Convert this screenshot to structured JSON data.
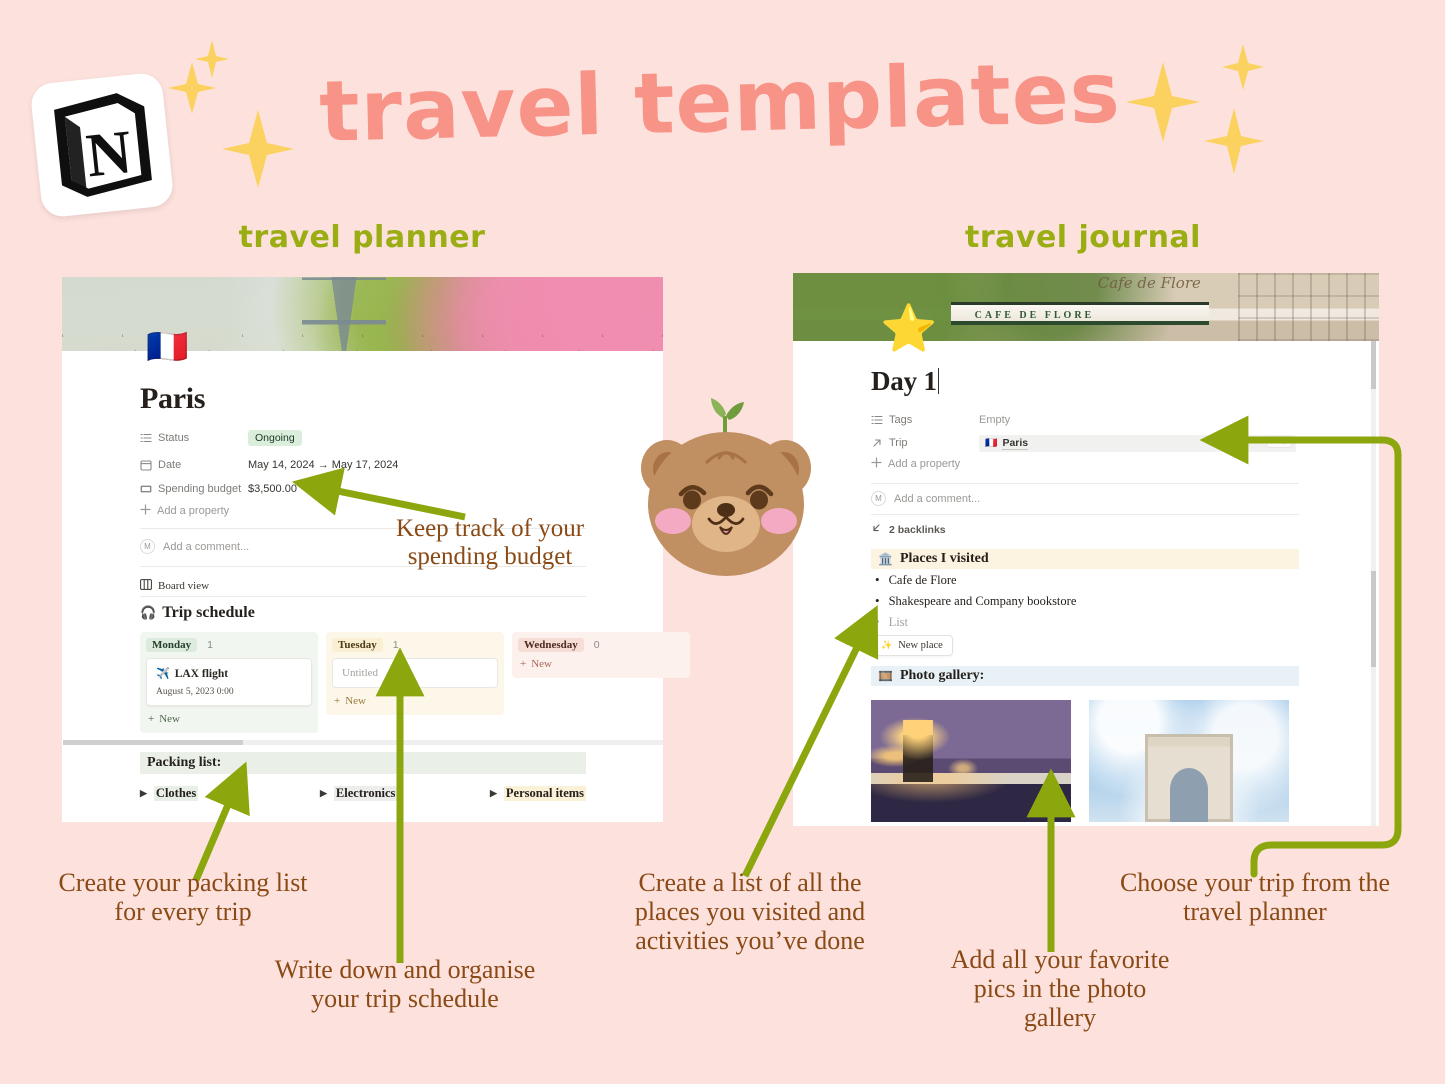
{
  "colors": {
    "background": "#fde1dd",
    "title_pink": "#f79387",
    "label_green": "#9aad12",
    "arrow_green": "#8ca60d",
    "anno_brown": "#8a4a16",
    "status_green_bg": "#dbeddb"
  },
  "header": {
    "title": "travel templates",
    "logo_letter": "N",
    "logo_name": "notion-logo",
    "label_planner": "travel planner",
    "label_journal": "travel journal"
  },
  "planner": {
    "cover_alt": "eiffel-tower-spring-blossoms-cover",
    "page_emoji": "🇫🇷",
    "title": "Paris",
    "properties": [
      {
        "icon": "list-icon",
        "label": "Status",
        "value": "Ongoing",
        "type": "select"
      },
      {
        "icon": "calendar-icon",
        "label": "Date",
        "value": "May 14, 2024 → May 17, 2024",
        "type": "text"
      },
      {
        "icon": "money-icon",
        "label": "Spending budget",
        "value": "$3,500.00",
        "type": "text"
      }
    ],
    "add_property": "Add a property",
    "comment_placeholder": "Add a comment...",
    "comment_avatar": "M",
    "board_view_label": "Board view",
    "schedule_heading": "Trip schedule",
    "schedule_emoji": "🎧",
    "board": {
      "columns": [
        {
          "name": "Monday",
          "count": "1",
          "cards": [
            {
              "emoji": "✈️",
              "title": "LAX flight",
              "subtitle": "August 5, 2023 0:00"
            }
          ],
          "placeholder": null,
          "new_label": "New"
        },
        {
          "name": "Tuesday",
          "count": "1",
          "cards": [],
          "placeholder": "Untitled",
          "new_label": "New"
        },
        {
          "name": "Wednesday",
          "count": "0",
          "cards": [],
          "placeholder": null,
          "new_label": "New"
        }
      ]
    },
    "packing_heading": "Packing list:",
    "packing_items": [
      "Clothes",
      "Electronics",
      "Personal items"
    ]
  },
  "journal": {
    "cover_alt": "cafe-de-flore-paris-cover",
    "cover_text_sign": "CAFE DE FLORE",
    "cover_text_script": "Cafe de Flore",
    "page_emoji": "⭐",
    "title": "Day 1",
    "properties": [
      {
        "icon": "list-icon",
        "label": "Tags",
        "value": "Empty",
        "muted": true
      },
      {
        "icon": "arrow-up-right-icon",
        "label": "Trip",
        "value": "Paris",
        "relation_emoji": "🇫🇷",
        "muted": false
      }
    ],
    "relation_controls": {
      "minus": "−",
      "plus": "+"
    },
    "add_property": "Add a property",
    "comment_placeholder": "Add a comment...",
    "comment_avatar": "M",
    "backlinks": "2 backlinks",
    "places_heading": "Places I visited",
    "places_emoji": "🏛️",
    "places": [
      {
        "text": "Cafe de Flore",
        "muted": false
      },
      {
        "text": "Shakespeare and Company bookstore",
        "muted": false
      },
      {
        "text": "List",
        "muted": true
      }
    ],
    "new_place_label": "New place",
    "new_place_emoji": "✨",
    "gallery_heading": "Photo gallery:",
    "gallery_emoji": "🎞️",
    "gallery_images": [
      {
        "alt": "pont-alexandre-iii-bridge-at-dusk"
      },
      {
        "alt": "arc-de-triomphe-blue-sky"
      }
    ]
  },
  "annotations": [
    {
      "id": "budget",
      "text": "Keep track of your\nspending budget"
    },
    {
      "id": "packing",
      "text": "Create your packing list\nfor every trip"
    },
    {
      "id": "schedule",
      "text": "Write down and organise\nyour trip schedule"
    },
    {
      "id": "places",
      "text": "Create a list of all the\nplaces you visited and\nactivities you’ve done"
    },
    {
      "id": "photos",
      "text": "Add all your favorite\npics in the photo\ngallery"
    },
    {
      "id": "trip",
      "text": "Choose your trip from the\ntravel planner"
    }
  ]
}
